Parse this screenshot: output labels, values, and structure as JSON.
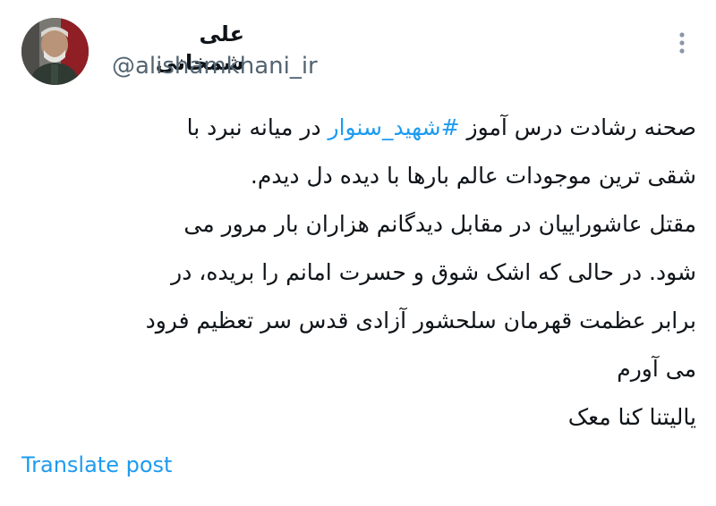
{
  "author": {
    "display_name": "علی شمخانی",
    "handle": "@alishamkhani_ir"
  },
  "menu": {
    "icon": "more-horizontal-icon"
  },
  "post": {
    "line1": {
      "before": "صحنه رشادت درس آموز ",
      "hashtag": "#شهید_سنوار",
      "after": " در میانه نبرد با"
    },
    "line2": "شقی ترین موجودات عالم بارها با دیده دل دیدم.",
    "line3": "مقتل عاشوراییان در مقابل دیدگانم هزاران بار مرور می",
    "line4": "شود. در حالی که اشک شوق و حسرت امانم را بریده، در",
    "line5": "برابر عظمت قهرمان سلحشور آزادی قدس سر تعظیم فرود",
    "line6": "می آورم",
    "line7": "یالیتنا کنا معک"
  },
  "translate_label": "Translate post",
  "colors": {
    "link": "#1d9bf0",
    "text": "#0f1419",
    "secondary": "#536471"
  }
}
